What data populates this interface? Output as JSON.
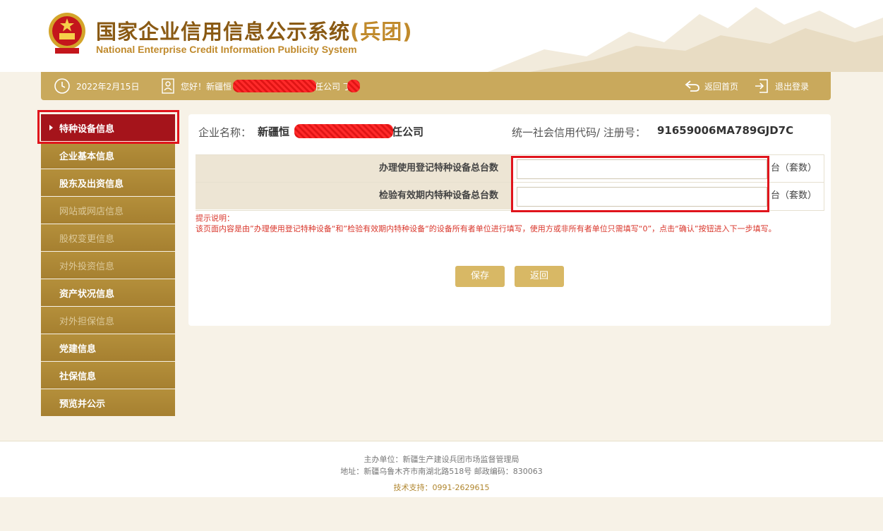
{
  "header": {
    "title_cn": "国家企业信用信息公示系统",
    "title_suffix": "(兵团)",
    "title_en": "National Enterprise Credit Information Publicity System"
  },
  "topbar": {
    "date": "2022年2月15日",
    "greeting_prefix": "您好！新疆恒",
    "greeting_suffix": "任公司 丁",
    "home_label": "返回首页",
    "logout_label": "退出登录"
  },
  "sidebar": {
    "items": [
      {
        "label": "特种设备信息",
        "state": "active"
      },
      {
        "label": "企业基本信息",
        "state": "enabled"
      },
      {
        "label": "股东及出资信息",
        "state": "enabled"
      },
      {
        "label": "网站或网店信息",
        "state": "disabled"
      },
      {
        "label": "股权变更信息",
        "state": "disabled"
      },
      {
        "label": "对外投资信息",
        "state": "disabled"
      },
      {
        "label": "资产状况信息",
        "state": "enabled"
      },
      {
        "label": "对外担保信息",
        "state": "disabled"
      },
      {
        "label": "党建信息",
        "state": "enabled"
      },
      {
        "label": "社保信息",
        "state": "enabled"
      },
      {
        "label": "预览并公示",
        "state": "enabled"
      }
    ]
  },
  "company": {
    "name_label": "企业名称：",
    "name_visible_prefix": "新疆恒",
    "name_visible_suffix": "责任公司",
    "code_label": "统一社会信用代码/ 注册号：",
    "code_value": "91659006MA789GJD7C"
  },
  "form": {
    "rows": [
      {
        "label": "办理使用登记特种设备总台数",
        "value": "",
        "unit": "台（套数）"
      },
      {
        "label": "检验有效期内特种设备总台数",
        "value": "",
        "unit": "台（套数）"
      }
    ],
    "note_title": "提示说明：",
    "note_body": "该页面内容是由”办理使用登记特种设备“和”检验有效期内特种设备“的设备所有者单位进行填写，使用方或非所有者单位只需填写“0”，点击“确认”按钮进入下一步填写。",
    "save_label": "保存",
    "back_label": "返回"
  },
  "footer": {
    "host": "主办单位：新疆生产建设兵团市场监督管理局",
    "address": "地址：新疆乌鲁木齐市南湖北路518号 邮政编码：830063",
    "support": "技术支持：0991-2629615"
  },
  "colors": {
    "accent_gold": "#c9a95c",
    "sidebar_gold": "#b48f3b",
    "active_red": "#a5141b",
    "highlight_red": "#e0141c",
    "note_red": "#d9362b"
  }
}
